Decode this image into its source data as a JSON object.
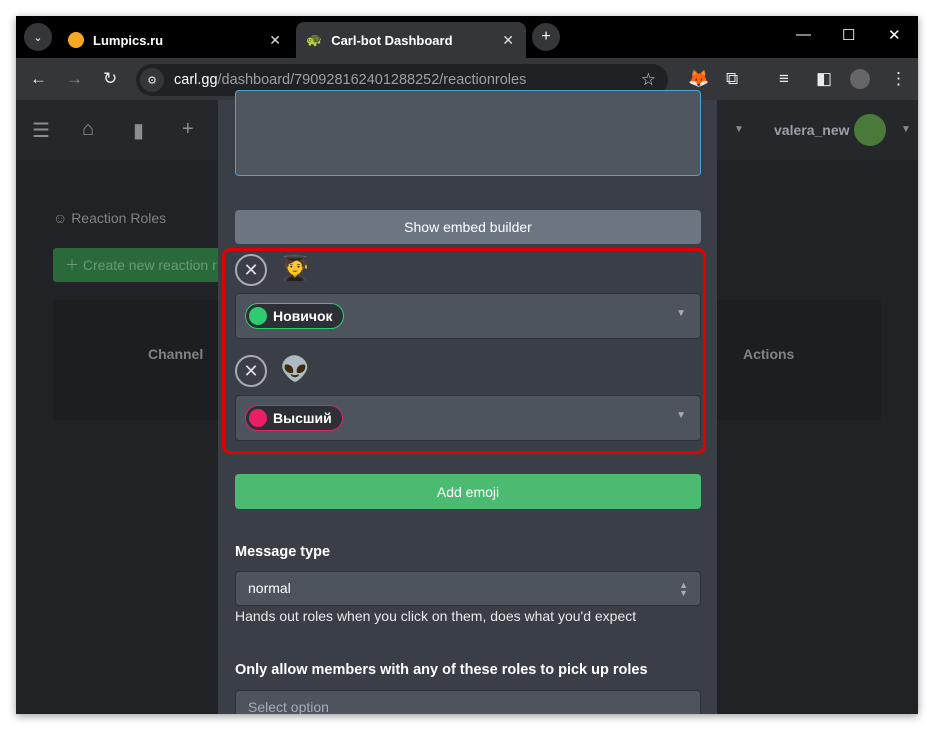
{
  "browser": {
    "tabs": [
      {
        "label": "Lumpics.ru",
        "icon": "orange-circle-icon"
      },
      {
        "label": "Carl-bot Dashboard",
        "icon": "turtle-icon",
        "active": true
      }
    ],
    "url_host": "carl.gg",
    "url_path": "/dashboard/790928162401288252/reactionroles"
  },
  "nav": {
    "username": "valera_new"
  },
  "background": {
    "section_title": "Reaction Roles",
    "create_button": "Create new reaction r",
    "col_channel": "Channel",
    "col_actions": "Actions"
  },
  "modal": {
    "embed_button": "Show embed builder",
    "reactions": [
      {
        "emoji": "🧑‍🎓",
        "role": "Новичок",
        "role_color": "#2ecc71"
      },
      {
        "emoji": "👽",
        "role": "Высший",
        "role_color": "#e91e63"
      }
    ],
    "add_emoji": "Add emoji",
    "message_type_label": "Message type",
    "message_type_value": "normal",
    "message_type_help": "Hands out roles when you click on them, does what you'd expect",
    "allow_label": "Only allow members with any of these roles to pick up roles",
    "allow_placeholder": "Select option"
  },
  "colors": {
    "highlight": "#e00000",
    "accent_green": "#4cbb72"
  }
}
